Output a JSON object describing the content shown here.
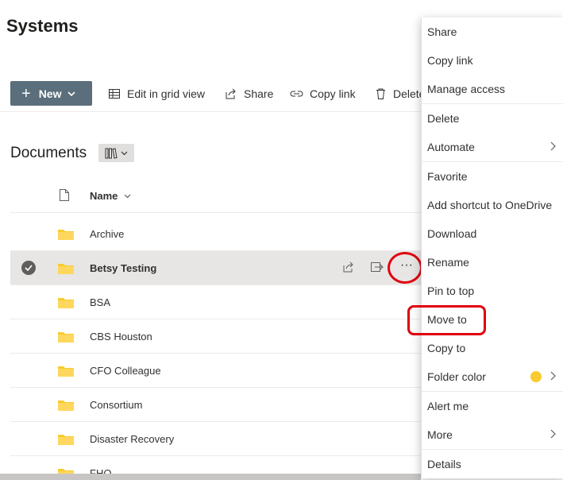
{
  "page": {
    "title": "Systems"
  },
  "toolbar": {
    "new_label": "New",
    "edit_grid_label": "Edit in grid view",
    "share_label": "Share",
    "copy_link_label": "Copy link",
    "delete_label": "Delete"
  },
  "library": {
    "title": "Documents"
  },
  "list": {
    "name_header": "Name",
    "rows": [
      {
        "name": "Archive"
      },
      {
        "name": "Betsy Testing",
        "selected": true
      },
      {
        "name": "BSA"
      },
      {
        "name": "CBS Houston"
      },
      {
        "name": "CFO Colleague"
      },
      {
        "name": "Consortium"
      },
      {
        "name": "Disaster Recovery"
      },
      {
        "name": "FHO"
      }
    ]
  },
  "context_menu": {
    "items": [
      {
        "label": "Share"
      },
      {
        "label": "Copy link"
      },
      {
        "label": "Manage access"
      },
      {
        "label": "Delete"
      },
      {
        "label": "Automate",
        "submenu": true
      },
      {
        "label": "Favorite"
      },
      {
        "label": "Add shortcut to OneDrive"
      },
      {
        "label": "Download"
      },
      {
        "label": "Rename"
      },
      {
        "label": "Pin to top"
      },
      {
        "label": "Move to",
        "highlighted": true
      },
      {
        "label": "Copy to"
      },
      {
        "label": "Folder color",
        "submenu": true,
        "swatch": "#f8cb2e"
      },
      {
        "label": "Alert me"
      },
      {
        "label": "More",
        "submenu": true
      },
      {
        "label": "Details"
      }
    ]
  },
  "colors": {
    "new_button_bg": "#5a6e7b",
    "folder": "#f8cb2e",
    "annotation_red": "#e0000f",
    "selected_row_bg": "#e8e6e4"
  }
}
